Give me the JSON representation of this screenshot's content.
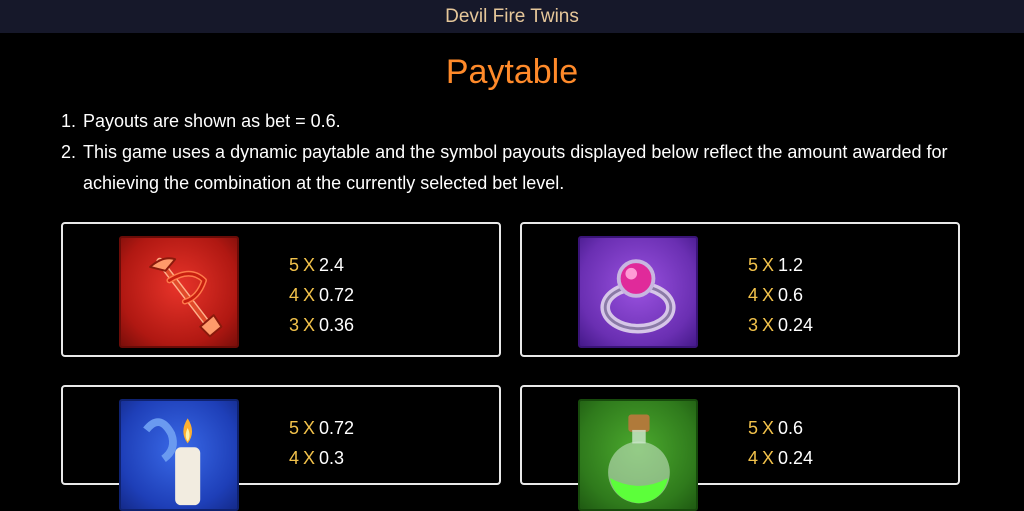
{
  "header": {
    "title": "Devil Fire Twins"
  },
  "page_title": "Paytable",
  "notes": [
    {
      "num": "1.",
      "text": "Payouts are shown as bet = 0.6."
    },
    {
      "num": "2.",
      "text": "This game uses a dynamic paytable and the symbol payouts displayed below reflect the amount awarded for achieving the combination at the currently selected bet level."
    }
  ],
  "symbols": [
    {
      "icon": "trident-icon",
      "bg": "#c8211a",
      "payouts": [
        {
          "count": "5",
          "mult": "X",
          "value": "2.4"
        },
        {
          "count": "4",
          "mult": "X",
          "value": "0.72"
        },
        {
          "count": "3",
          "mult": "X",
          "value": "0.36"
        }
      ]
    },
    {
      "icon": "ring-icon",
      "bg": "#7a3bc4",
      "payouts": [
        {
          "count": "5",
          "mult": "X",
          "value": "1.2"
        },
        {
          "count": "4",
          "mult": "X",
          "value": "0.6"
        },
        {
          "count": "3",
          "mult": "X",
          "value": "0.24"
        }
      ]
    },
    {
      "icon": "candle-icon",
      "bg": "#1f48c8",
      "payouts": [
        {
          "count": "5",
          "mult": "X",
          "value": "0.72"
        },
        {
          "count": "4",
          "mult": "X",
          "value": "0.3"
        }
      ]
    },
    {
      "icon": "potion-icon",
      "bg": "#3a8a22",
      "payouts": [
        {
          "count": "5",
          "mult": "X",
          "value": "0.6"
        },
        {
          "count": "4",
          "mult": "X",
          "value": "0.24"
        }
      ]
    }
  ]
}
